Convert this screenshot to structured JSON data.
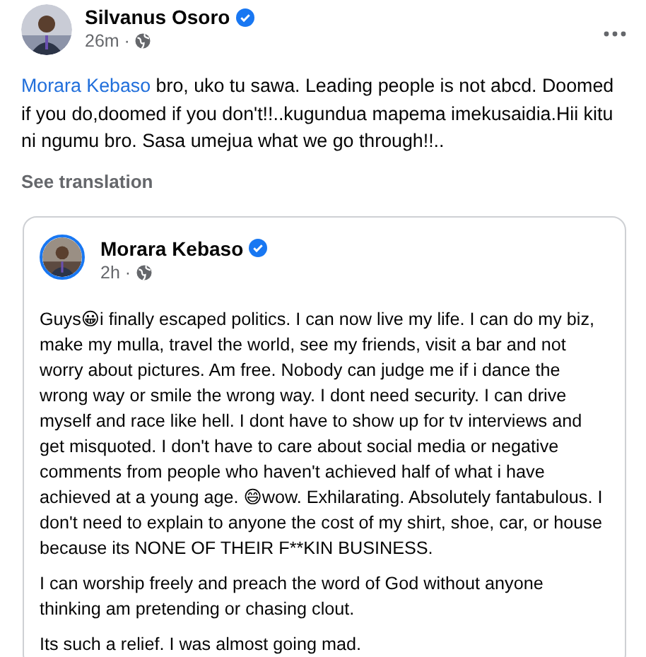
{
  "post": {
    "author": "Silvanus Osoro",
    "verified": true,
    "time": "26m ·",
    "text": {
      "mention": "Morara Kebaso",
      "body": " bro, uko tu sawa. Leading people is not abcd. Doomed if you do,doomed if you don't!!..kugundua mapema imekusaidia.Hii kitu ni ngumu bro. Sasa umejua what we go through!!.."
    },
    "see_translation": "See translation"
  },
  "shared_post": {
    "author": "Morara Kebaso",
    "verified": true,
    "time": "2h ·",
    "paragraphs": [
      "Guys😀i finally escaped politics. I can now live my life. I can do my biz, make my mulla, travel the world, see my friends, visit a bar and not worry about pictures. Am free. Nobody can judge me if i dance the wrong way or smile the wrong way. I dont need security. I can drive myself and race like hell. I dont have to show up for tv interviews and get misquoted. I don't have to care about social media or negative comments from people who haven't achieved half of what i have achieved at a young age. 😄wow. Exhilarating. Absolutely fantabulous. I don't need to explain to anyone the cost of my shirt, shoe, car, or house because its NONE OF THEIR F**KIN BUSINESS.",
      "I can worship freely and preach the word of God without anyone thinking am pretending or chasing clout.",
      "Its such a relief. I was almost going mad."
    ]
  }
}
